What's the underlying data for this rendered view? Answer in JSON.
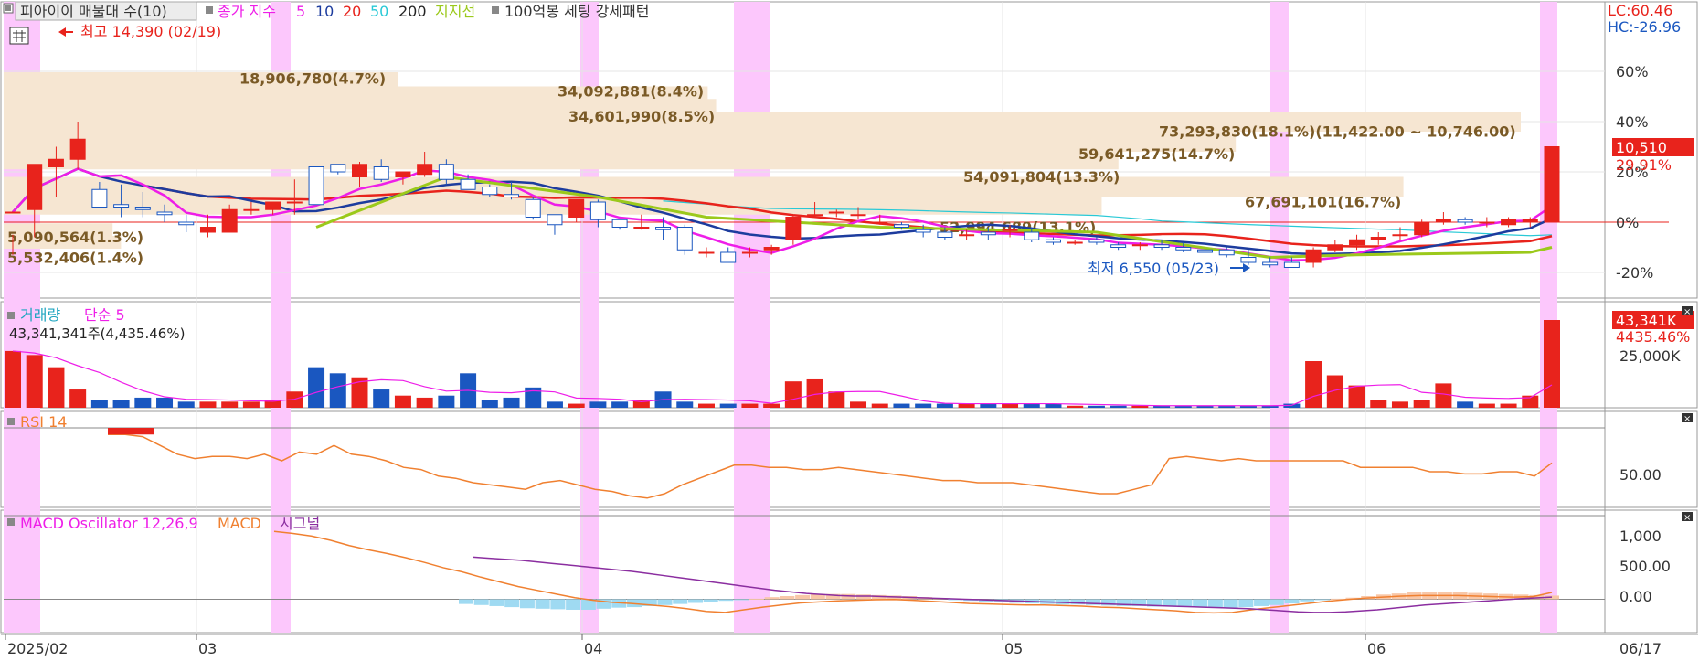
{
  "panels": {
    "price": {
      "title": "피아이이 매물대 수(10)",
      "ma_label": "종가 지수",
      "ma_periods": [
        "5",
        "10",
        "20",
        "50",
        "200"
      ],
      "support_label": "지지선",
      "pattern_label": "100억봉 세팅 강세패턴",
      "high_note": "최고 14,390 (02/19)",
      "low_note": "최저 6,550 (05/23)",
      "lc": "LC:60.46",
      "hc": "HC:-26.96",
      "last_price": "10,510",
      "last_change": "29.91%"
    },
    "volume": {
      "title": "거래량",
      "ma_label": "단순 5",
      "summary": "43,341,341주(4,435.46%)",
      "last_value": "43,341K",
      "last_pct": "4435.46%",
      "y_tick": "25,000K"
    },
    "rsi": {
      "title": "RSI 14",
      "y_tick": "50.00"
    },
    "macd": {
      "title": "MACD Oscillator 12,26,9",
      "macd_label": "MACD",
      "signal_label": "시그널",
      "y_ticks": [
        "1,000",
        "500.00",
        "0.00"
      ]
    }
  },
  "x_axis": {
    "labels": [
      "2025/02",
      "03",
      "04",
      "05",
      "06"
    ],
    "end_label": "06/17"
  },
  "colors": {
    "up": "#e8231c",
    "down": "#1a57c0",
    "ma5": "#ee1ee8",
    "ma10": "#1d3c9e",
    "ma20": "#e8231c",
    "ma50": "#29c9d6",
    "support": "#9bc91b",
    "highlight": "#fcc7fc",
    "profile": "#f6e6d2",
    "profile_text": "#7a5a26",
    "rsi": "#f08030",
    "macd": "#f08030",
    "signal": "#8b2ea0",
    "osc": "#9fdaf2",
    "osc_pos": "#f8c7a8"
  },
  "chart_data": {
    "type": "candlestick",
    "y_ticks": [
      "60%",
      "40%",
      "20%",
      "0%",
      "-20%"
    ],
    "volume_profile": [
      {
        "label": "5,090,564(1.3%)",
        "pct": 1.3
      },
      {
        "label": "5,532,406(1.4%)",
        "pct": 1.4
      },
      {
        "label": "18,906,780(4.7%)",
        "pct": 4.7
      },
      {
        "label": "34,092,881(8.4%)",
        "pct": 8.4
      },
      {
        "label": "34,601,990(8.5%)",
        "pct": 8.5
      },
      {
        "label": "73,293,830(18.1%)(11,422.00 ~ 10,746.00)",
        "pct": 18.1
      },
      {
        "label": "59,641,275(14.7%)",
        "pct": 14.7
      },
      {
        "label": "54,091,804(13.3%)",
        "pct": 13.3
      },
      {
        "label": "67,691,101(16.7%)",
        "pct": 16.7
      },
      {
        "label": "52,994,689(13.1%)",
        "pct": 13.1
      }
    ],
    "candles": [
      [
        4,
        -5,
        -13,
        4
      ],
      [
        5,
        10,
        -6,
        23
      ],
      [
        22,
        30,
        10,
        25
      ],
      [
        25,
        40,
        21,
        33
      ],
      [
        13,
        16,
        6,
        6
      ],
      [
        7,
        15,
        2,
        6
      ],
      [
        6,
        12,
        2,
        5
      ],
      [
        4,
        7,
        0,
        3
      ],
      [
        0,
        3,
        -4,
        -1
      ],
      [
        -4,
        3,
        -6,
        -2
      ],
      [
        -4,
        7,
        -4,
        5
      ],
      [
        5,
        8,
        3,
        5
      ],
      [
        5,
        8,
        3,
        8
      ],
      [
        8,
        17,
        3,
        8
      ],
      [
        22,
        22,
        7,
        7
      ],
      [
        23,
        23,
        19,
        20
      ],
      [
        18,
        24,
        14,
        23
      ],
      [
        22,
        25,
        16,
        17
      ],
      [
        18,
        20,
        15,
        20
      ],
      [
        19,
        28,
        18,
        23
      ],
      [
        23,
        25,
        15,
        17
      ],
      [
        17,
        19,
        13,
        13
      ],
      [
        14,
        15,
        10,
        11
      ],
      [
        11,
        16,
        9,
        10
      ],
      [
        9,
        10,
        1,
        2
      ],
      [
        3,
        3,
        -5,
        -1
      ],
      [
        2,
        9,
        0,
        9
      ],
      [
        8,
        9,
        -2,
        1
      ],
      [
        1,
        1,
        -3,
        -2
      ],
      [
        -2,
        3,
        -3,
        -2
      ],
      [
        -2,
        2,
        -7,
        -3
      ],
      [
        -2,
        -1,
        -13,
        -11
      ],
      [
        -12,
        -10,
        -14,
        -12
      ],
      [
        -12,
        -10,
        -16,
        -16
      ],
      [
        -12,
        -10,
        -14,
        -12
      ],
      [
        -11,
        -9,
        -13,
        -10
      ],
      [
        -7,
        3,
        -9,
        2
      ],
      [
        3,
        8,
        2,
        3
      ],
      [
        4,
        5,
        2,
        4
      ],
      [
        3,
        6,
        1,
        3
      ],
      [
        0,
        3,
        -1,
        0
      ],
      [
        -1,
        0,
        -3,
        -2
      ],
      [
        -3,
        -1,
        -6,
        -4
      ],
      [
        -4,
        -2,
        -7,
        -6
      ],
      [
        -5,
        -3,
        -7,
        -5
      ],
      [
        -4,
        -2,
        -7,
        -5
      ],
      [
        -3,
        -1,
        -6,
        -3
      ],
      [
        -4,
        -2,
        -8,
        -7
      ],
      [
        -7,
        -6,
        -9,
        -8
      ],
      [
        -8,
        -7,
        -9,
        -8
      ],
      [
        -7,
        -6,
        -9,
        -8
      ],
      [
        -9,
        -8,
        -11,
        -10
      ],
      [
        -9,
        -8,
        -11,
        -9
      ],
      [
        -9,
        -7,
        -11,
        -10
      ],
      [
        -10,
        -8,
        -12,
        -11
      ],
      [
        -11,
        -9,
        -13,
        -12
      ],
      [
        -11,
        -10,
        -14,
        -13
      ],
      [
        -14,
        -11,
        -17,
        -16
      ],
      [
        -16,
        -14,
        -18,
        -17
      ],
      [
        -16,
        -14,
        -18,
        -18
      ],
      [
        -16,
        -10,
        -18,
        -11
      ],
      [
        -11,
        -7,
        -12,
        -9
      ],
      [
        -9,
        -5,
        -11,
        -7
      ],
      [
        -7,
        -4,
        -9,
        -6
      ],
      [
        -5,
        -2,
        -7,
        -5
      ],
      [
        -5,
        1,
        -6,
        0
      ],
      [
        0,
        4,
        -1,
        1
      ],
      [
        1,
        2,
        -1,
        0
      ],
      [
        0,
        2,
        -2,
        0
      ],
      [
        -1,
        2,
        -2,
        1
      ],
      [
        0,
        2,
        -2,
        1
      ],
      [
        0,
        30,
        0,
        30
      ]
    ],
    "volume": [
      28,
      26,
      20,
      9,
      4,
      4,
      5,
      5,
      3,
      3,
      3,
      3,
      4,
      8,
      20,
      17,
      15,
      9,
      6,
      5,
      6,
      17,
      4,
      5,
      10,
      3,
      2,
      3,
      3,
      4,
      8,
      3,
      2,
      2,
      2,
      2,
      13,
      14,
      8,
      3,
      2,
      2,
      2,
      2,
      2,
      2,
      2,
      2,
      2,
      1,
      1,
      1,
      1,
      1,
      1,
      1,
      1,
      1,
      1,
      2,
      23,
      16,
      11,
      4,
      3,
      4,
      12,
      3,
      2,
      2,
      6,
      43.3
    ],
    "rsi": [
      67,
      67,
      66,
      62,
      58,
      56,
      57,
      57,
      56,
      58,
      55,
      59,
      58,
      62,
      58,
      57,
      55,
      52,
      51,
      48,
      47,
      45,
      44,
      43,
      42,
      45,
      46,
      44,
      42,
      41,
      39,
      38,
      40,
      44,
      47,
      50,
      53,
      53,
      52,
      52,
      51,
      51,
      52,
      51,
      50,
      49,
      48,
      47,
      46,
      46,
      45,
      45,
      45,
      44,
      43,
      42,
      41,
      40,
      40,
      42,
      44,
      56,
      57,
      56,
      55,
      56,
      55,
      55,
      55,
      55,
      55,
      55,
      52,
      52,
      52,
      52,
      50,
      50,
      49,
      49,
      50,
      50,
      48,
      54
    ],
    "macd": [
      1290,
      1250,
      1200,
      1120,
      1020,
      940,
      870,
      790,
      700,
      600,
      520,
      420,
      330,
      240,
      170,
      100,
      30,
      -20,
      -60,
      -80,
      -110,
      -140,
      -180,
      -230,
      -250,
      -200,
      -150,
      -110,
      -70,
      -50,
      -30,
      -20,
      -10,
      -5,
      -20,
      -40,
      -60,
      -80,
      -90,
      -100,
      -110,
      -110,
      -120,
      -130,
      -150,
      -160,
      -180,
      -200,
      -220,
      -250,
      -260,
      -250,
      -200,
      -160,
      -120,
      -80,
      -40,
      -10,
      20,
      40,
      60,
      70,
      70,
      70,
      60,
      50,
      40,
      50,
      130
    ],
    "signal": [
      800,
      780,
      760,
      740,
      710,
      680,
      650,
      620,
      590,
      560,
      530,
      490,
      450,
      410,
      370,
      330,
      290,
      250,
      210,
      170,
      140,
      110,
      90,
      70,
      60,
      60,
      50,
      40,
      30,
      20,
      10,
      0,
      -10,
      -20,
      -30,
      -40,
      -50,
      -60,
      -70,
      -80,
      -90,
      -100,
      -110,
      -120,
      -130,
      -140,
      -150,
      -160,
      -170,
      -180,
      -200,
      -220,
      -240,
      -250,
      -250,
      -240,
      -220,
      -200,
      -170,
      -140,
      -110,
      -90,
      -70,
      -50,
      -30,
      -10,
      10,
      25,
      40
    ],
    "oscillator": [
      -90,
      -110,
      -130,
      -150,
      -170,
      -180,
      -190,
      -200,
      -200,
      -180,
      -160,
      -150,
      -130,
      -110,
      -90,
      -70,
      -50,
      -30,
      -10,
      10,
      40,
      60,
      80,
      100,
      100,
      100,
      90,
      80,
      70,
      60,
      40,
      20,
      -10,
      -30,
      -50,
      -60,
      -70,
      -80,
      -90,
      -100,
      -100,
      -110,
      -120,
      -130,
      -130,
      -140,
      -140,
      -150,
      -150,
      -150,
      -160,
      -150,
      -130,
      -110,
      -80,
      -40,
      -10,
      10,
      30,
      60,
      90,
      110,
      130,
      140,
      140,
      130,
      120,
      110,
      100,
      90,
      80,
      70
    ],
    "ylim_macd": [
      -600,
      1450
    ]
  }
}
